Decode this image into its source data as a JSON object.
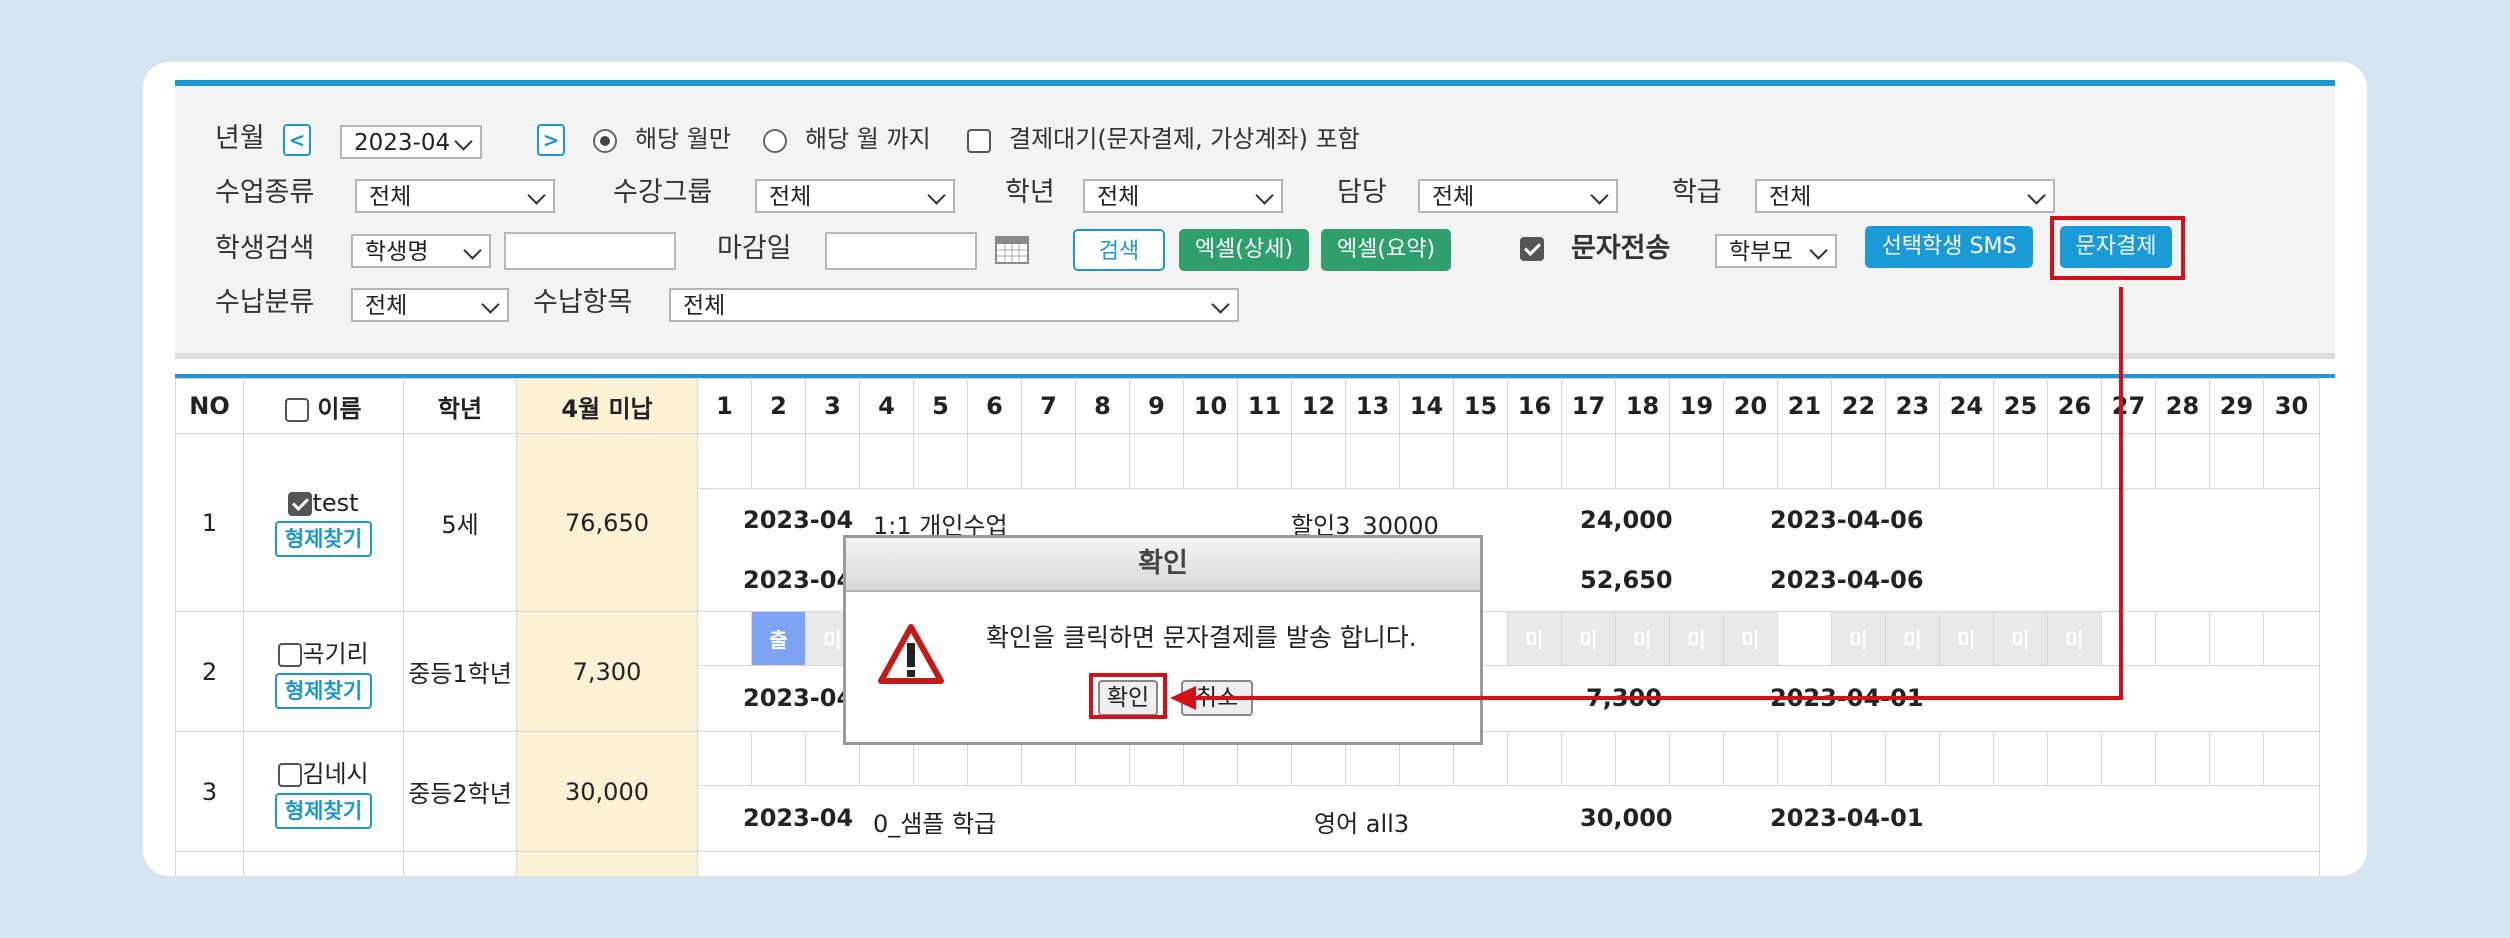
{
  "filters": {
    "month_label": "년월",
    "month_value": "2023-04",
    "radio_this_month": "해당 월만",
    "radio_until_month": "해당 월 까지",
    "include_pending": "결제대기(문자결제, 가상계좌) 포함",
    "class_type_label": "수업종류",
    "class_type_value": "전체",
    "group_label": "수강그룹",
    "group_value": "전체",
    "grade_label": "학년",
    "grade_value": "전체",
    "manager_label": "담당",
    "manager_value": "전체",
    "level_label": "학급",
    "level_value": "전체",
    "student_search_label": "학생검색",
    "student_search_value": "학생명",
    "deadline_label": "마감일",
    "search_button": "검색",
    "excel_detail_button": "엑셀(상세)",
    "excel_summary_button": "엑셀(요약)",
    "sms_send_label": "문자전송",
    "sms_target_value": "학부모",
    "selected_sms_button": "선택학생 SMS",
    "sms_payment_button": "문자결제",
    "payment_category_label": "수납분류",
    "payment_category_value": "전체",
    "payment_item_label": "수납항목",
    "payment_item_value": "전체"
  },
  "table": {
    "headers": {
      "no": "NO",
      "name": "이름",
      "grade": "학년",
      "unpaid": "4월 미납"
    },
    "days": [
      "1",
      "2",
      "3",
      "4",
      "5",
      "6",
      "7",
      "8",
      "9",
      "10",
      "11",
      "12",
      "13",
      "14",
      "15",
      "16",
      "17",
      "18",
      "19",
      "20",
      "21",
      "22",
      "23",
      "24",
      "25",
      "26",
      "27",
      "28",
      "29",
      "30"
    ],
    "sibling_button": "형제찾기",
    "att_present": "출",
    "att_unpaid": "미",
    "rows": [
      {
        "no": "1",
        "name": "test",
        "grade": "5세",
        "unpaid": "76,650",
        "payments": [
          {
            "month": "2023-04",
            "item": "1:1 개인수업",
            "discount": "할인3_30000",
            "amount": "24,000",
            "date": "2023-04-06"
          },
          {
            "month": "2023-04",
            "item": "",
            "discount": "",
            "amount": "52,650",
            "date": "2023-04-06"
          }
        ]
      },
      {
        "no": "2",
        "name": "곡기리",
        "grade": "중등1학년",
        "unpaid": "7,300",
        "payments": [
          {
            "month": "2023-04",
            "item": "",
            "discount": "",
            "amount": "7,300",
            "date": "2023-04-01"
          }
        ]
      },
      {
        "no": "3",
        "name": "김네시",
        "grade": "중등2학년",
        "unpaid": "30,000",
        "payments": [
          {
            "month": "2023-04",
            "item": "0_샘플 학급",
            "discount": "영어 all3",
            "amount": "30,000",
            "date": "2023-04-01"
          }
        ]
      }
    ]
  },
  "dialog": {
    "title": "확인",
    "message": "확인을 클릭하면 문자결제를 발송 합니다.",
    "ok": "확인",
    "cancel": "취소"
  },
  "colors": {
    "accent": "#1e96cf",
    "highlight": "#d4101a",
    "unpaid_bg": "#fbf1d5",
    "excel": "#2e9f6d"
  },
  "icons": {
    "warning": "warning-icon",
    "calendar": "calendar-icon"
  }
}
